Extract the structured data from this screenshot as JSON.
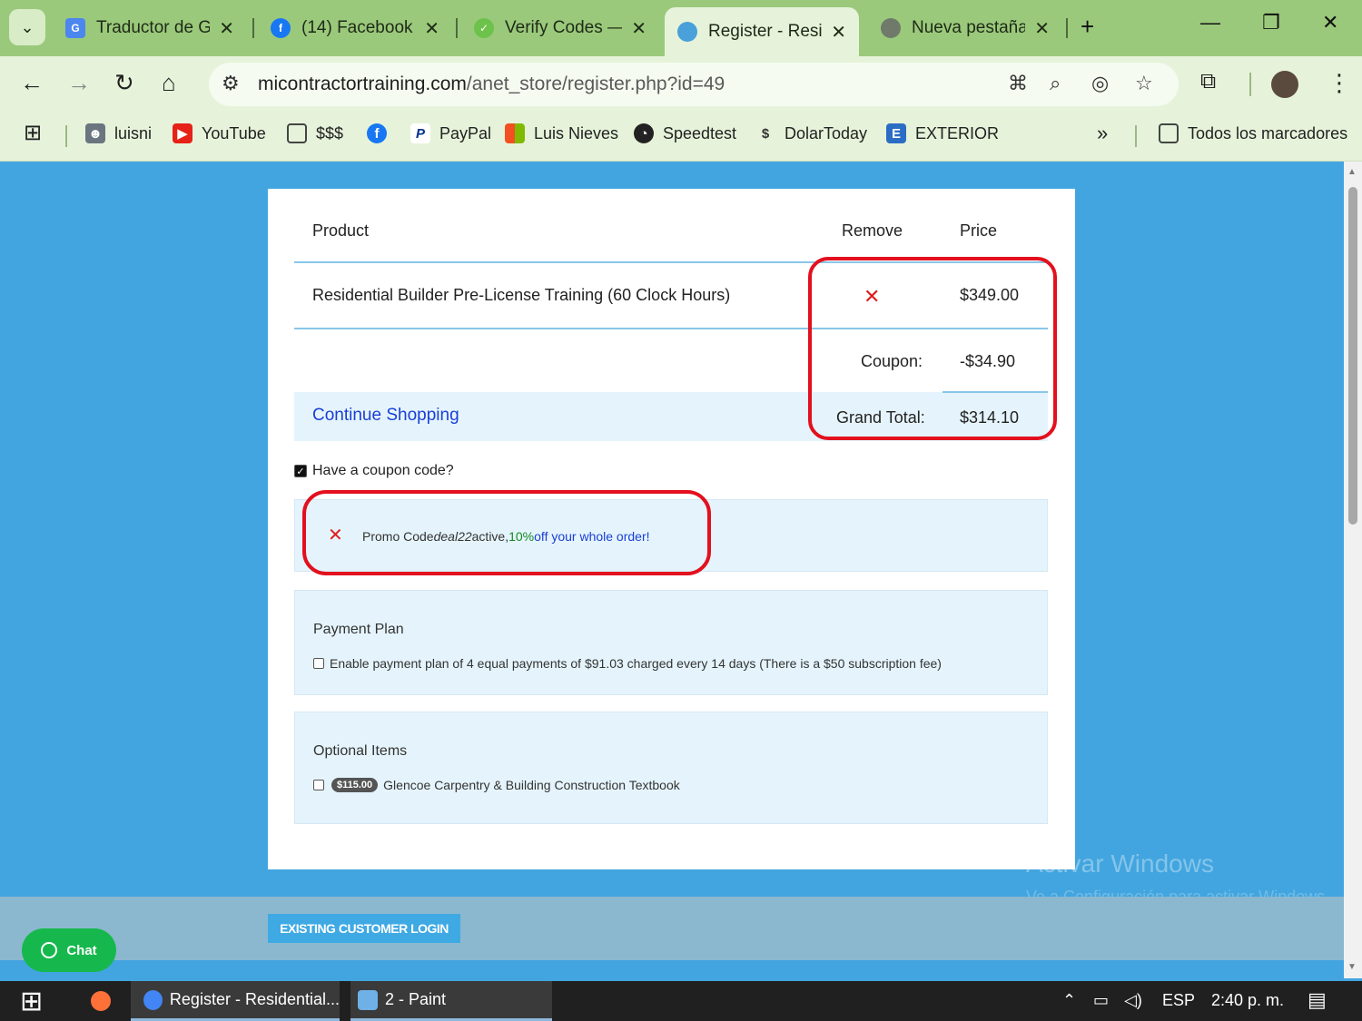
{
  "browser": {
    "tabs": [
      {
        "title": "Traductor de Go",
        "icon": "google-translate-icon",
        "active": false
      },
      {
        "title": "(14) Facebook",
        "icon": "facebook-icon",
        "active": false
      },
      {
        "title": "Verify Codes —",
        "icon": "verify-icon",
        "active": false
      },
      {
        "title": "Register - Resid",
        "icon": "site-icon",
        "active": true
      },
      {
        "title": "Nueva pestaña",
        "icon": "chrome-icon",
        "active": false
      }
    ],
    "url_host": "micontractortraining.com",
    "url_path": "/anet_store/register.php?id=49",
    "bookmarks": [
      {
        "label": "luisni"
      },
      {
        "label": "YouTube"
      },
      {
        "label": "$$$"
      },
      {
        "label": ""
      },
      {
        "label": "PayPal"
      },
      {
        "label": "Luis Nieves"
      },
      {
        "label": "Speedtest"
      },
      {
        "label": "DolarToday"
      },
      {
        "label": "EXTERIOR"
      }
    ],
    "all_bookmarks": "Todos los marcadores"
  },
  "cart": {
    "headers": {
      "product": "Product",
      "remove": "Remove",
      "price": "Price"
    },
    "item": {
      "name": "Residential Builder Pre-License Training (60 Clock Hours)",
      "price": "$349.00"
    },
    "coupon_label": "Coupon:",
    "coupon_value": "-$34.90",
    "grand_total_label": "Grand Total:",
    "grand_total_value": "$314.10",
    "continue_shopping": "Continue Shopping"
  },
  "coupon": {
    "checkbox_label": "Have a coupon code?",
    "promo_prefix": "Promo Code ",
    "promo_code": "deal22",
    "promo_active": " active, ",
    "promo_percent": "10%",
    "promo_suffix": " off your whole order!"
  },
  "payment_plan": {
    "title": "Payment Plan",
    "option": "Enable payment plan of 4 equal payments of $91.03 charged every 14 days (There is a $50 subscription fee)"
  },
  "optional_items": {
    "title": "Optional Items",
    "price": "$115.00",
    "item": "Glencoe Carpentry & Building Construction Textbook"
  },
  "login_button": "EXISTING CUSTOMER LOGIN",
  "chat_button": "Chat",
  "watermark": {
    "title": "Activar Windows",
    "subtitle": "Ve a Configuración para activar Windows."
  },
  "taskbar": {
    "items": [
      {
        "label": "Register - Residential..."
      },
      {
        "label": "2 - Paint"
      }
    ],
    "language": "ESP",
    "time": "2:40 p. m."
  },
  "colors": {
    "tab_bar": "#9bc97b",
    "page_bg": "#42a5df",
    "highlight": "#e3101e",
    "link": "#1a3fd6"
  }
}
